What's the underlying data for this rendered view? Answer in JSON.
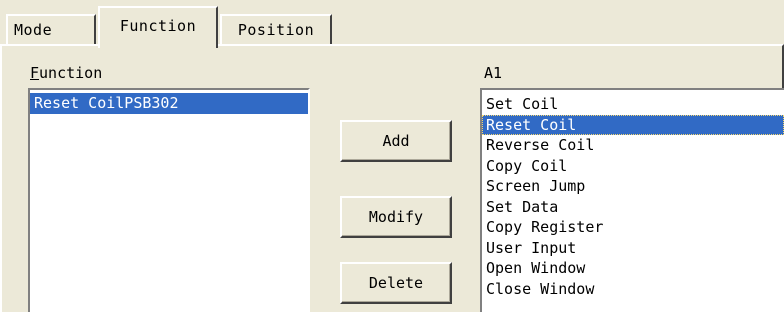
{
  "tabs": [
    {
      "label": "Mode",
      "active": false
    },
    {
      "label": "Function",
      "active": true
    },
    {
      "label": "Position",
      "active": false
    }
  ],
  "function_panel": {
    "label": "Function",
    "items": [
      "Reset CoilPSB302"
    ],
    "selected_index": 0
  },
  "buttons": {
    "add": "Add",
    "modify": "Modify",
    "delete": "Delete"
  },
  "a1_panel": {
    "label": "A1",
    "items": [
      "Set Coil",
      "Reset Coil",
      "Reverse Coil",
      "Copy Coil",
      "Screen Jump",
      "Set Data",
      "Copy Register",
      "User Input",
      "Open Window",
      "Close Window"
    ],
    "selected_index": 1
  },
  "colors": {
    "face": "#ece9d8",
    "selection": "#316ac5",
    "list_background": "#ffffff"
  }
}
